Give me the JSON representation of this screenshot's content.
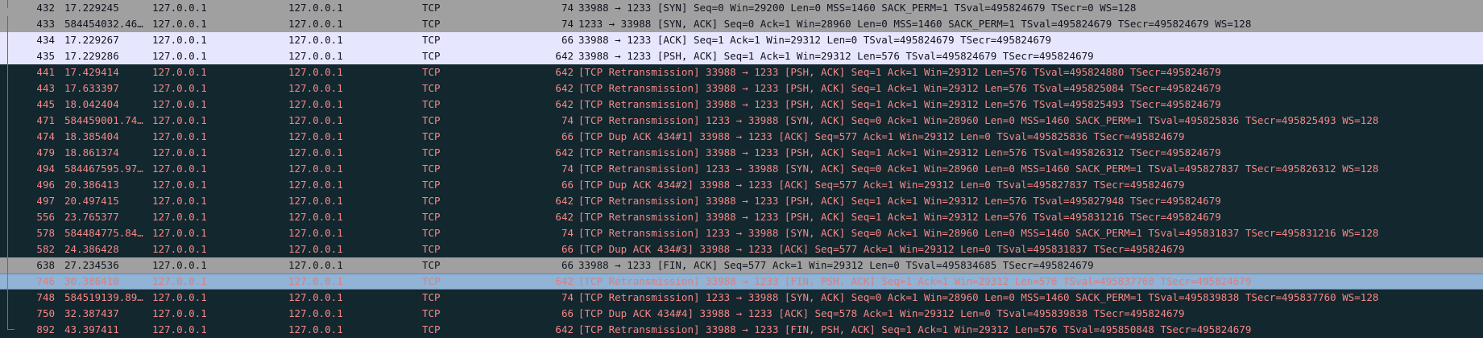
{
  "packets": [
    {
      "no": "432",
      "time": "17.229245",
      "src": "127.0.0.1",
      "dst": "127.0.0.1",
      "proto": "TCP",
      "len": "74",
      "info": "33988 → 1233 [SYN] Seq=0 Win=29200 Len=0 MSS=1460 SACK_PERM=1 TSval=495824679 TSecr=0 WS=128",
      "style": "syn"
    },
    {
      "no": "433",
      "time": "584454032.46…",
      "src": "127.0.0.1",
      "dst": "127.0.0.1",
      "proto": "TCP",
      "len": "74",
      "info": "1233 → 33988 [SYN, ACK] Seq=0 Ack=1 Win=28960 Len=0 MSS=1460 SACK_PERM=1 TSval=495824679 TSecr=495824679 WS=128",
      "style": "syn"
    },
    {
      "no": "434",
      "time": "17.229267",
      "src": "127.0.0.1",
      "dst": "127.0.0.1",
      "proto": "TCP",
      "len": "66",
      "info": "33988 → 1233 [ACK] Seq=1 Ack=1 Win=29312 Len=0 TSval=495824679 TSecr=495824679",
      "style": "ack"
    },
    {
      "no": "435",
      "time": "17.229286",
      "src": "127.0.0.1",
      "dst": "127.0.0.1",
      "proto": "TCP",
      "len": "642",
      "info": "33988 → 1233 [PSH, ACK] Seq=1 Ack=1 Win=29312 Len=576 TSval=495824679 TSecr=495824679",
      "style": "ack"
    },
    {
      "no": "441",
      "time": "17.429414",
      "src": "127.0.0.1",
      "dst": "127.0.0.1",
      "proto": "TCP",
      "len": "642",
      "info": "[TCP Retransmission] 33988 → 1233 [PSH, ACK] Seq=1 Ack=1 Win=29312 Len=576 TSval=495824880 TSecr=495824679",
      "style": "bad"
    },
    {
      "no": "443",
      "time": "17.633397",
      "src": "127.0.0.1",
      "dst": "127.0.0.1",
      "proto": "TCP",
      "len": "642",
      "info": "[TCP Retransmission] 33988 → 1233 [PSH, ACK] Seq=1 Ack=1 Win=29312 Len=576 TSval=495825084 TSecr=495824679",
      "style": "bad"
    },
    {
      "no": "445",
      "time": "18.042404",
      "src": "127.0.0.1",
      "dst": "127.0.0.1",
      "proto": "TCP",
      "len": "642",
      "info": "[TCP Retransmission] 33988 → 1233 [PSH, ACK] Seq=1 Ack=1 Win=29312 Len=576 TSval=495825493 TSecr=495824679",
      "style": "bad"
    },
    {
      "no": "471",
      "time": "584459001.74…",
      "src": "127.0.0.1",
      "dst": "127.0.0.1",
      "proto": "TCP",
      "len": "74",
      "info": "[TCP Retransmission] 1233 → 33988 [SYN, ACK] Seq=0 Ack=1 Win=28960 Len=0 MSS=1460 SACK_PERM=1 TSval=495825836 TSecr=495825493 WS=128",
      "style": "bad"
    },
    {
      "no": "474",
      "time": "18.385404",
      "src": "127.0.0.1",
      "dst": "127.0.0.1",
      "proto": "TCP",
      "len": "66",
      "info": "[TCP Dup ACK 434#1] 33988 → 1233 [ACK] Seq=577 Ack=1 Win=29312 Len=0 TSval=495825836 TSecr=495824679",
      "style": "bad"
    },
    {
      "no": "479",
      "time": "18.861374",
      "src": "127.0.0.1",
      "dst": "127.0.0.1",
      "proto": "TCP",
      "len": "642",
      "info": "[TCP Retransmission] 33988 → 1233 [PSH, ACK] Seq=1 Ack=1 Win=29312 Len=576 TSval=495826312 TSecr=495824679",
      "style": "bad"
    },
    {
      "no": "494",
      "time": "584467595.97…",
      "src": "127.0.0.1",
      "dst": "127.0.0.1",
      "proto": "TCP",
      "len": "74",
      "info": "[TCP Retransmission] 1233 → 33988 [SYN, ACK] Seq=0 Ack=1 Win=28960 Len=0 MSS=1460 SACK_PERM=1 TSval=495827837 TSecr=495826312 WS=128",
      "style": "bad"
    },
    {
      "no": "496",
      "time": "20.386413",
      "src": "127.0.0.1",
      "dst": "127.0.0.1",
      "proto": "TCP",
      "len": "66",
      "info": "[TCP Dup ACK 434#2] 33988 → 1233 [ACK] Seq=577 Ack=1 Win=29312 Len=0 TSval=495827837 TSecr=495824679",
      "style": "bad"
    },
    {
      "no": "497",
      "time": "20.497415",
      "src": "127.0.0.1",
      "dst": "127.0.0.1",
      "proto": "TCP",
      "len": "642",
      "info": "[TCP Retransmission] 33988 → 1233 [PSH, ACK] Seq=1 Ack=1 Win=29312 Len=576 TSval=495827948 TSecr=495824679",
      "style": "bad"
    },
    {
      "no": "556",
      "time": "23.765377",
      "src": "127.0.0.1",
      "dst": "127.0.0.1",
      "proto": "TCP",
      "len": "642",
      "info": "[TCP Retransmission] 33988 → 1233 [PSH, ACK] Seq=1 Ack=1 Win=29312 Len=576 TSval=495831216 TSecr=495824679",
      "style": "bad"
    },
    {
      "no": "578",
      "time": "584484775.84…",
      "src": "127.0.0.1",
      "dst": "127.0.0.1",
      "proto": "TCP",
      "len": "74",
      "info": "[TCP Retransmission] 1233 → 33988 [SYN, ACK] Seq=0 Ack=1 Win=28960 Len=0 MSS=1460 SACK_PERM=1 TSval=495831837 TSecr=495831216 WS=128",
      "style": "bad"
    },
    {
      "no": "582",
      "time": "24.386428",
      "src": "127.0.0.1",
      "dst": "127.0.0.1",
      "proto": "TCP",
      "len": "66",
      "info": "[TCP Dup ACK 434#3] 33988 → 1233 [ACK] Seq=577 Ack=1 Win=29312 Len=0 TSval=495831837 TSecr=495824679",
      "style": "bad"
    },
    {
      "no": "638",
      "time": "27.234536",
      "src": "127.0.0.1",
      "dst": "127.0.0.1",
      "proto": "TCP",
      "len": "66",
      "info": "33988 → 1233 [FIN, ACK] Seq=577 Ack=1 Win=29312 Len=0 TSval=495834685 TSecr=495824679",
      "style": "fin"
    },
    {
      "no": "746",
      "time": "30.386410",
      "src": "127.0.0.1",
      "dst": "127.0.0.1",
      "proto": "TCP",
      "len": "642",
      "info": "[TCP Retransmission] 33988 → 1233 [FIN, PSH, ACK] Seq=1 Ack=1 Win=29312 Len=576 TSval=495837760 TSecr=495824679",
      "style": "sel"
    },
    {
      "no": "748",
      "time": "584519139.89…",
      "src": "127.0.0.1",
      "dst": "127.0.0.1",
      "proto": "TCP",
      "len": "74",
      "info": "[TCP Retransmission] 1233 → 33988 [SYN, ACK] Seq=0 Ack=1 Win=28960 Len=0 MSS=1460 SACK_PERM=1 TSval=495839838 TSecr=495837760 WS=128",
      "style": "bad"
    },
    {
      "no": "750",
      "time": "32.387437",
      "src": "127.0.0.1",
      "dst": "127.0.0.1",
      "proto": "TCP",
      "len": "66",
      "info": "[TCP Dup ACK 434#4] 33988 → 1233 [ACK] Seq=578 Ack=1 Win=29312 Len=0 TSval=495839838 TSecr=495824679",
      "style": "bad"
    },
    {
      "no": "892",
      "time": "43.397411",
      "src": "127.0.0.1",
      "dst": "127.0.0.1",
      "proto": "TCP",
      "len": "642",
      "info": "[TCP Retransmission] 33988 → 1233 [FIN, PSH, ACK] Seq=1 Ack=1 Win=29312 Len=576 TSval=495850848 TSecr=495824679",
      "style": "bad"
    }
  ],
  "colors": {
    "syn_bg": "#a0a0a0",
    "ack_bg": "#e7e6ff",
    "bad_bg": "#12272e",
    "bad_fg": "#f78787",
    "selected_bg": "#90b3d6"
  }
}
